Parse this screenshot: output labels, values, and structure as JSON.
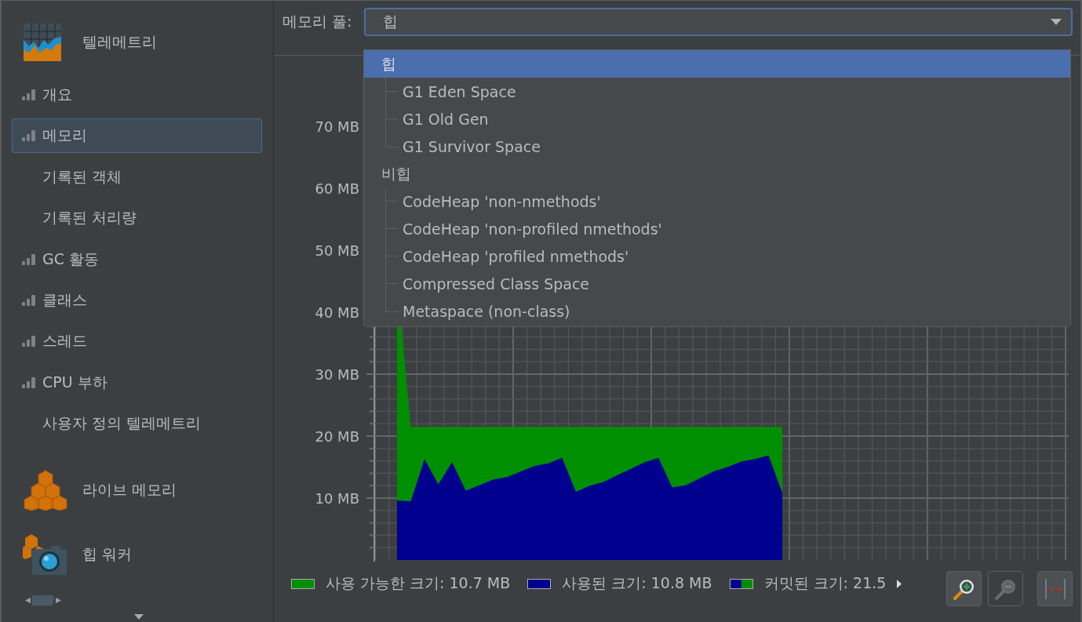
{
  "sidebar": {
    "sections": [
      {
        "label": "텔레메트리",
        "items": [
          {
            "label": "개요",
            "kind": "meter",
            "selected": false
          },
          {
            "label": "메모리",
            "kind": "meter",
            "selected": true
          },
          {
            "label": "기록된 객체",
            "kind": "view",
            "selected": false
          },
          {
            "label": "기록된 처리량",
            "kind": "view",
            "selected": false
          },
          {
            "label": "GC 활동",
            "kind": "meter",
            "selected": false
          },
          {
            "label": "클래스",
            "kind": "meter",
            "selected": false
          },
          {
            "label": "스레드",
            "kind": "meter",
            "selected": false
          },
          {
            "label": "CPU 부하",
            "kind": "meter",
            "selected": false
          },
          {
            "label": "사용자 정의 텔레메트리",
            "kind": "view",
            "selected": false
          }
        ]
      },
      {
        "label": "라이브 메모리"
      },
      {
        "label": "힙 워커"
      }
    ]
  },
  "pool_selector": {
    "label": "메모리 풀:",
    "value": "힙",
    "expanded": true,
    "options": [
      {
        "label": "힙",
        "selected": true,
        "children": [
          {
            "label": "G1 Eden Space",
            "selected": false
          },
          {
            "label": "G1 Old Gen",
            "selected": false
          },
          {
            "label": "G1 Survivor Space",
            "selected": false
          }
        ]
      },
      {
        "label": "비힙",
        "selected": false,
        "children": [
          {
            "label": "CodeHeap 'non-nmethods'",
            "selected": false
          },
          {
            "label": "CodeHeap 'non-profiled nmethods'",
            "selected": false
          },
          {
            "label": "CodeHeap 'profiled nmethods'",
            "selected": false
          },
          {
            "label": "Compressed Class Space",
            "selected": false
          },
          {
            "label": "Metaspace (non-class)",
            "selected": false
          }
        ]
      }
    ]
  },
  "chart": {
    "chart_data": {
      "type": "area",
      "categories": [
        null,
        null,
        null,
        null,
        null,
        null,
        null,
        null,
        null,
        null,
        null,
        null,
        null,
        null,
        null,
        null,
        null,
        null,
        null,
        null,
        null,
        null,
        null,
        null,
        null,
        null,
        null,
        null,
        null
      ],
      "series": [
        {
          "color": "#008f00",
          "values": [
            45,
            21.5,
            21.5,
            21.5,
            21.5,
            21.5,
            21.5,
            21.5,
            21.5,
            21.5,
            21.5,
            21.5,
            21.5,
            21.5,
            21.5,
            21.5,
            21.5,
            21.5,
            21.5,
            21.5,
            21.5,
            21.5,
            21.5,
            21.5,
            21.5,
            21.5,
            21.5,
            21.5,
            21.5
          ]
        },
        {
          "color": "#00008f",
          "values": [
            9.6,
            9.5,
            16.3,
            12.2,
            15.8,
            11.2,
            12.1,
            13.0,
            13.4,
            14.3,
            15.2,
            15.6,
            16.5,
            11.0,
            12.0,
            12.6,
            13.7,
            14.7,
            15.8,
            16.5,
            11.7,
            12.1,
            13.2,
            14.3,
            15.0,
            15.9,
            16.3,
            16.9,
            10.8
          ]
        }
      ],
      "grid": true,
      "ylim": [
        0,
        80
      ],
      "yticks": [
        {
          "value": 10,
          "label": "10 MB"
        },
        {
          "value": 20,
          "label": "20 MB"
        },
        {
          "value": 30,
          "label": "30 MB"
        },
        {
          "value": 40,
          "label": "40 MB"
        },
        {
          "value": 50,
          "label": "50 MB"
        },
        {
          "value": 60,
          "label": "60 MB"
        },
        {
          "value": 70,
          "label": "70 MB"
        }
      ]
    },
    "legend": [
      {
        "label": "사용 가능한 크기: 10.7 MB",
        "kind": "solid",
        "color": "#008f00"
      },
      {
        "label": "사용된 크기: 10.8 MB",
        "kind": "solid",
        "color": "#00008f"
      },
      {
        "label": "커밋된 크기: 21.5",
        "kind": "split"
      }
    ]
  },
  "toolbar": [
    {
      "kind": "zoom-in",
      "disabled": false
    },
    {
      "kind": "zoom-out",
      "disabled": true
    },
    {
      "kind": "fit",
      "disabled": false
    }
  ]
}
